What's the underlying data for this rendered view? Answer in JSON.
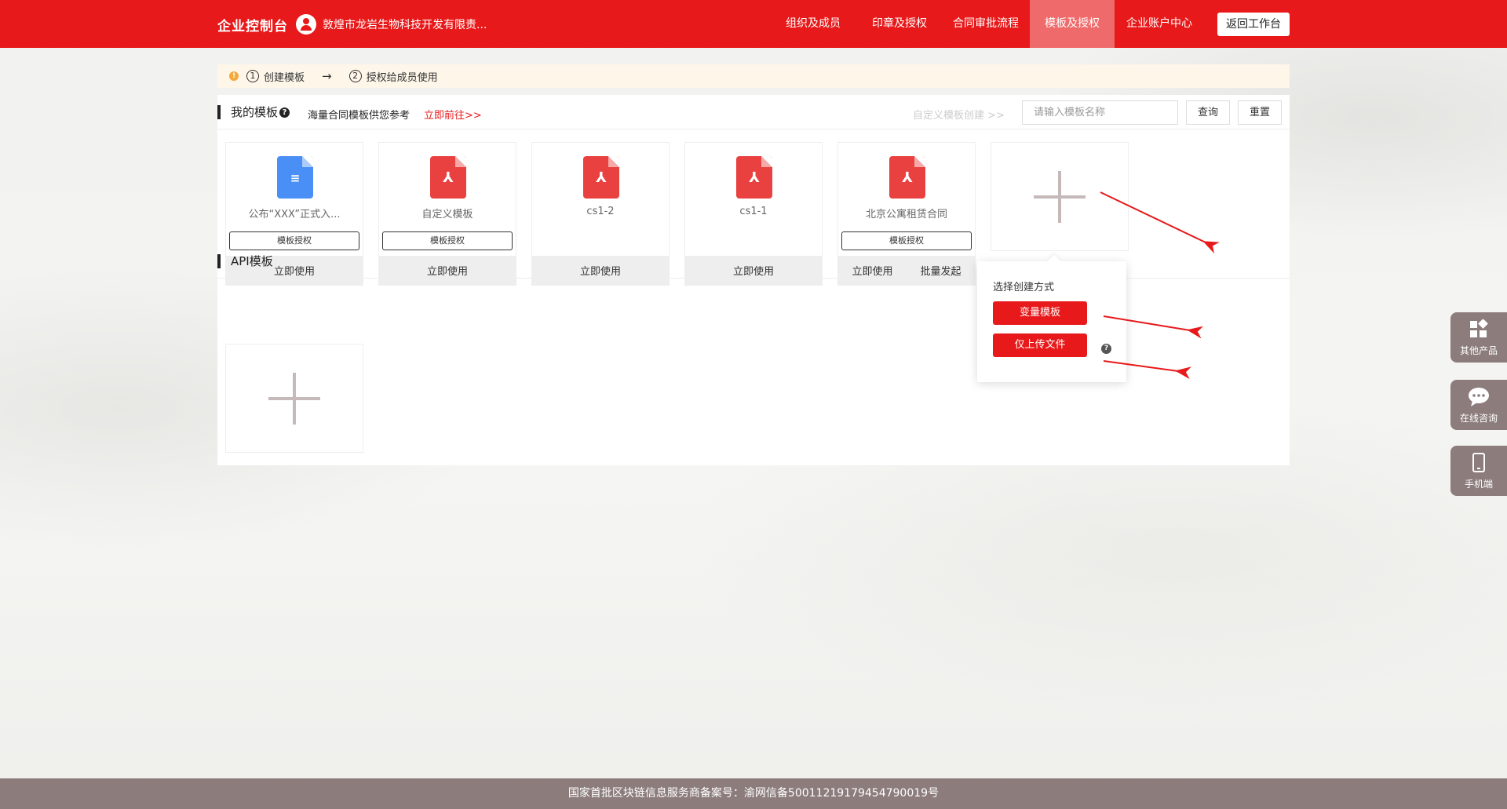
{
  "header": {
    "brand": "企业控制台",
    "company": "敦煌市龙岩生物科技开发有限责...",
    "nav": [
      {
        "label": "组织及成员",
        "active": false
      },
      {
        "label": "印章及授权",
        "active": false
      },
      {
        "label": "合同审批流程",
        "active": false
      },
      {
        "label": "模板及授权",
        "active": true
      },
      {
        "label": "企业账户中心",
        "active": false
      }
    ],
    "back_label": "返回工作台"
  },
  "steps": {
    "warn": "!",
    "step1_num": "1",
    "step1": "创建模板",
    "arrow": "→",
    "step2_num": "2",
    "step2": "授权给成员使用"
  },
  "my_templates": {
    "title": "我的模板",
    "help": "?",
    "ref_text": "海量合同模板供您参考",
    "ref_link": "立即前往>>",
    "custom_create": "自定义模板创建 >>",
    "search_placeholder": "请输入模板名称",
    "query_label": "查询",
    "reset_label": "重置",
    "cards": [
      {
        "name": "公布“XXX”正式入...",
        "icon": "word-doc-icon",
        "auth": "模板授权",
        "actions": [
          "立即使用"
        ]
      },
      {
        "name": "自定义模板",
        "icon": "pdf-icon",
        "auth": "模板授权",
        "actions": [
          "立即使用"
        ]
      },
      {
        "name": "cs1-2",
        "icon": "pdf-icon",
        "auth": "",
        "actions": [
          "立即使用"
        ]
      },
      {
        "name": "cs1-1",
        "icon": "pdf-icon",
        "auth": "",
        "actions": [
          "立即使用"
        ]
      },
      {
        "name": "北京公寓租赁合同",
        "icon": "pdf-icon",
        "auth": "模板授权",
        "actions": [
          "立即使用",
          "批量发起"
        ]
      }
    ]
  },
  "api_templates": {
    "title": "API模板"
  },
  "popover": {
    "title": "选择创建方式",
    "option1": "变量模板",
    "option2": "仅上传文件",
    "help": "?"
  },
  "side": {
    "other": "其他产品",
    "consult": "在线咨询",
    "mobile": "手机端"
  },
  "footer": {
    "text": "国家首批区块链信息服务商备案号：渝网信备50011219179454790019号"
  },
  "colors": {
    "brand_red": "#e8191a",
    "nav_active": "#ef6a6a",
    "side_gray": "#8c7c7c",
    "pdf_red": "#e94040",
    "doc_blue": "#4a8ff5"
  }
}
